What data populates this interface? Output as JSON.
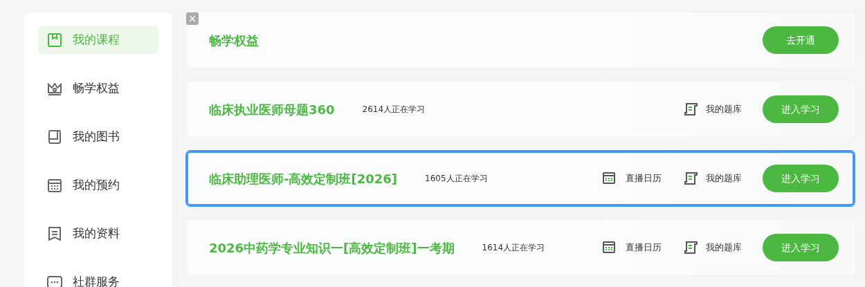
{
  "sidebar": {
    "items": [
      {
        "label": "我的课程",
        "kind": "courses",
        "selected": true
      },
      {
        "label": "畅学权益",
        "kind": "benefits",
        "selected": false
      },
      {
        "label": "我的图书",
        "kind": "books",
        "selected": false
      },
      {
        "label": "我的预约",
        "kind": "appointments",
        "selected": false
      },
      {
        "label": "我的资料",
        "kind": "materials",
        "selected": false
      },
      {
        "label": "社群服务",
        "kind": "community",
        "selected": false
      }
    ]
  },
  "close_badge": "×",
  "courses": [
    {
      "kind": "promo",
      "title": "畅学权益",
      "button": "去开通",
      "selected": false
    },
    {
      "kind": "course",
      "title": "临床执业医师母题360",
      "learners": "2614人正在学习",
      "links": [
        {
          "kind": "bank",
          "label": "我的题库"
        }
      ],
      "button": "进入学习",
      "selected": false
    },
    {
      "kind": "course",
      "title": "临床助理医师-高效定制班[2026]",
      "learners": "1605人正在学习",
      "links": [
        {
          "kind": "calendar",
          "label": "直播日历"
        },
        {
          "kind": "bank",
          "label": "我的题库"
        }
      ],
      "button": "进入学习",
      "selected": true
    },
    {
      "kind": "course",
      "title": "2026中药学专业知识一[高效定制班]一考期",
      "learners": "1614人正在学习",
      "links": [
        {
          "kind": "calendar",
          "label": "直播日历"
        },
        {
          "kind": "bank",
          "label": "我的题库"
        }
      ],
      "button": "进入学习",
      "selected": false
    }
  ]
}
